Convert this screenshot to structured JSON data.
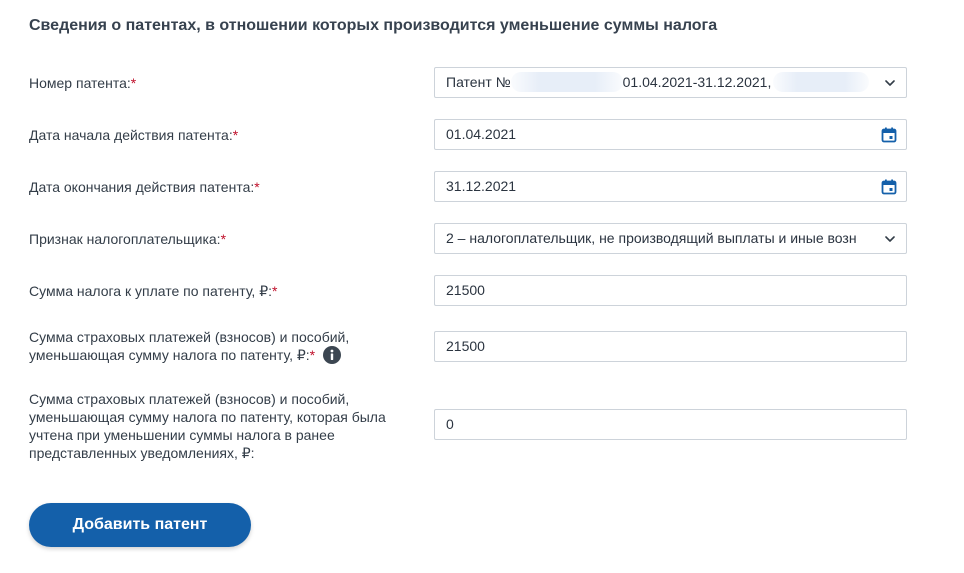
{
  "section": {
    "title": "Сведения о патентах, в отношении которых производится уменьшение суммы налога"
  },
  "fields": {
    "patent_number": {
      "label": "Номер патента:",
      "required_mark": "*",
      "value_prefix": "Патент №",
      "value_period": "01.04.2021-31.12.2021,",
      "icon": "chevron-down-icon"
    },
    "start_date": {
      "label": "Дата начала действия патента:",
      "required_mark": "*",
      "value": "01.04.2021",
      "icon": "calendar-icon"
    },
    "end_date": {
      "label": "Дата окончания действия патента:",
      "required_mark": "*",
      "value": "31.12.2021",
      "icon": "calendar-icon"
    },
    "taxpayer_sign": {
      "label": "Признак налогоплательщика:",
      "required_mark": "*",
      "value": "2 – налогоплательщик, не производящий выплаты и иные возн",
      "icon": "chevron-down-icon"
    },
    "tax_amount": {
      "label": "Сумма налога к уплате по патенту, ₽:",
      "required_mark": "*",
      "value": "21500"
    },
    "insurance_reduce": {
      "label_line1": "Сумма страховых платежей (взносов) и пособий,",
      "label_line2": "уменьшающая сумму налога по патенту, ₽:",
      "required_mark": "*",
      "value": "21500",
      "icon": "info-icon"
    },
    "insurance_previous": {
      "label_line1": "Сумма страховых платежей (взносов) и пособий,",
      "label_line2": "уменьшающая сумму налога по патенту, которая была",
      "label_line3": "учтена при уменьшении суммы налога в ранее",
      "label_line4": "представленных уведомлениях, ₽:",
      "value": "0"
    }
  },
  "actions": {
    "add_patent_label": "Добавить патент"
  },
  "colors": {
    "primary": "#1460aa",
    "required": "#c0102b",
    "border": "#cdd3da"
  }
}
